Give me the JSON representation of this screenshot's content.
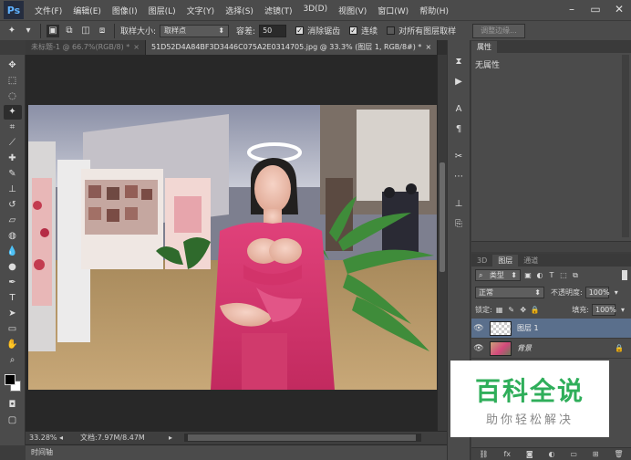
{
  "app": {
    "logo": "Ps"
  },
  "menu": [
    "文件(F)",
    "编辑(E)",
    "图像(I)",
    "图层(L)",
    "文字(Y)",
    "选择(S)",
    "滤镜(T)",
    "3D(D)",
    "视图(V)",
    "窗口(W)",
    "帮助(H)"
  ],
  "window_controls": {
    "minimize": "–",
    "restore": "▭",
    "close": "✕"
  },
  "options": {
    "sample_size_label": "取样大小:",
    "sample_size_value": "取样点",
    "tolerance_label": "容差:",
    "tolerance_value": "50",
    "antialias_label": "消除锯齿",
    "antialias_checked": true,
    "contiguous_label": "连续",
    "contiguous_checked": true,
    "sample_all_label": "对所有图层取样",
    "sample_all_checked": false,
    "refine_edge_button": "调整边缘..."
  },
  "tabs": [
    {
      "label": "未标题-1 @ 66.7%(RGB/8) *",
      "active": false
    },
    {
      "label": "51D52D4A84BF3D3446C075A2E0314705.jpg @ 33.3% (图层 1, RGB/8#) *",
      "active": true
    }
  ],
  "tools": [
    {
      "icon": "move-icon",
      "glyph": "✥"
    },
    {
      "icon": "marquee-icon",
      "glyph": "⬚"
    },
    {
      "icon": "lasso-icon",
      "glyph": "◌"
    },
    {
      "icon": "magic-wand-icon",
      "glyph": "✦",
      "active": true
    },
    {
      "icon": "crop-icon",
      "glyph": "⌗"
    },
    {
      "icon": "eyedropper-icon",
      "glyph": "⟋"
    },
    {
      "icon": "healing-brush-icon",
      "glyph": "✚"
    },
    {
      "icon": "brush-icon",
      "glyph": "✎"
    },
    {
      "icon": "clone-stamp-icon",
      "glyph": "⊥"
    },
    {
      "icon": "history-brush-icon",
      "glyph": "↺"
    },
    {
      "icon": "eraser-icon",
      "glyph": "▱"
    },
    {
      "icon": "paint-bucket-icon",
      "glyph": "◍"
    },
    {
      "icon": "blur-icon",
      "glyph": "💧"
    },
    {
      "icon": "dodge-icon",
      "glyph": "●"
    },
    {
      "icon": "pen-icon",
      "glyph": "✒"
    },
    {
      "icon": "type-icon",
      "glyph": "T"
    },
    {
      "icon": "path-selection-icon",
      "glyph": "➤"
    },
    {
      "icon": "shape-icon",
      "glyph": "▭"
    },
    {
      "icon": "hand-icon",
      "glyph": "✋"
    },
    {
      "icon": "zoom-icon",
      "glyph": "⌕"
    }
  ],
  "status": {
    "zoom": "33.28%",
    "doc_info": "文档:7.97M/8.47M",
    "timeline_label": "时间轴"
  },
  "properties_panel": {
    "tab": "属性",
    "body": "无属性"
  },
  "layers_panel": {
    "tabs": [
      "3D",
      "图层",
      "通道"
    ],
    "active_tab": "图层",
    "filter_kind": "类型",
    "blend_mode": "正常",
    "opacity_label": "不透明度:",
    "opacity_value": "100%",
    "lock_label": "锁定:",
    "fill_label": "填充:",
    "fill_value": "100%",
    "layers": [
      {
        "name": "图层 1",
        "selected": true,
        "locked": false
      },
      {
        "name": "背景",
        "selected": false,
        "locked": true
      }
    ],
    "footer_icons": [
      "link-icon",
      "fx-icon",
      "mask-icon",
      "adjustment-icon",
      "group-icon",
      "new-layer-icon",
      "trash-icon"
    ]
  },
  "watermark": {
    "title": "百科全说",
    "subtitle": "助你轻松解决"
  },
  "colors": {
    "accent": "#2fae5a",
    "selected_layer": "#5a6f8c",
    "fg_color": "#000000",
    "bg_color": "#ffffff"
  }
}
